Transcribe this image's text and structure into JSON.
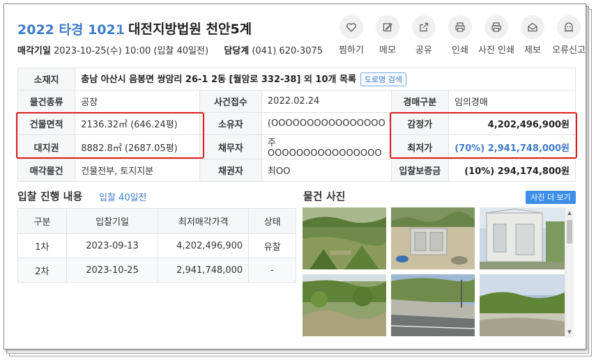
{
  "header": {
    "case_no": "2022 타경 1021",
    "court": "대전지방법원 천안5계",
    "sale_date_label": "매각기일",
    "sale_date_value": "2023-10-25(수) 10:00 (입찰 40일전)",
    "dept_label": "담당계",
    "dept_value": "(041) 620-3075"
  },
  "actions": [
    {
      "label": "찜하기",
      "icon": "heart-icon"
    },
    {
      "label": "메모",
      "icon": "edit-icon"
    },
    {
      "label": "공유",
      "icon": "share-icon"
    },
    {
      "label": "인쇄",
      "icon": "print-icon"
    },
    {
      "label": "사진 인쇄",
      "icon": "print-icon"
    },
    {
      "label": "제보",
      "icon": "mail-icon"
    },
    {
      "label": "오류신고",
      "icon": "ghost-icon"
    }
  ],
  "info": {
    "location_label": "소재지",
    "location_value": "충남 아산시 음봉면 쌍암리 26-1 2동 [월암로 332-38] 외 10개 목록",
    "road_btn": "도로명 검색",
    "type_label": "물건종류",
    "type_value": "공장",
    "received_label": "사건접수",
    "received_value": "2022.02.24",
    "auction_type_label": "경매구분",
    "auction_type_value": "임의경매",
    "building_area_label": "건물면적",
    "building_area_value": "2136.32㎡ (646.24평)",
    "owner_label": "소유자",
    "owner_value": "(OOOOOOOOOOOOOOOO",
    "appraisal_label": "감정가",
    "appraisal_value": "4,202,496,900원",
    "land_label": "대지권",
    "land_value": "8882.8㎡ (2687.05평)",
    "debtor_label": "채무자",
    "debtor_value": "주OOOOOOOOOOOOOOOO",
    "min_price_label": "최저가",
    "min_price_value": "(70%) 2,941,748,000원",
    "sale_items_label": "매각물건",
    "sale_items_value": "건물전부, 토지지분",
    "creditor_label": "채권자",
    "creditor_value": "최OO",
    "deposit_label": "입찰보증금",
    "deposit_value": "(10%) 294,174,800원"
  },
  "bid_progress": {
    "title": "입찰 진행 내용",
    "subtitle": "입찰 40일전",
    "columns": [
      "구분",
      "입찰기일",
      "최저매각가격",
      "상태"
    ],
    "rows": [
      [
        "1차",
        "2023-09-13",
        "4,202,496,900",
        "유찰"
      ],
      [
        "2차",
        "2023-10-25",
        "2,941,748,000",
        "-"
      ]
    ]
  },
  "photos": {
    "title": "물건 사진",
    "more_btn": "사진 더 보기"
  },
  "colors": {
    "accent": "#3d7cc9",
    "highlight": "#e01e1e",
    "button": "#3d8ee6"
  }
}
